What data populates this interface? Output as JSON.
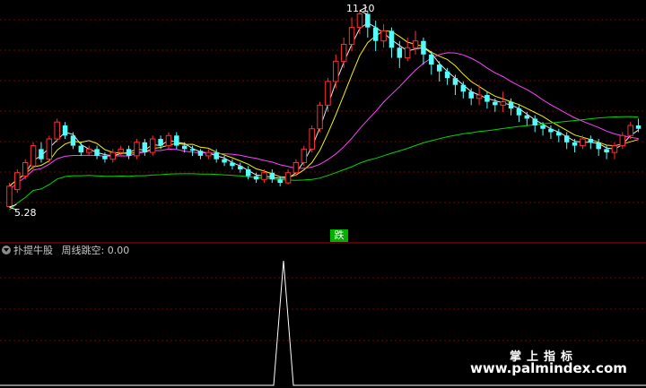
{
  "main_chart": {
    "high_label": "11.10",
    "low_label": "5.28",
    "signal_label": "跌",
    "colors": {
      "up": "#ff3030",
      "down": "#54fcfc",
      "ma_white": "#e8e8e8",
      "ma_yellow": "#f0f000",
      "ma_magenta": "#ff40ff",
      "ma_green": "#00d800",
      "grid": "#7a0000"
    }
  },
  "indicator": {
    "name": "扑提牛股",
    "series_label": "周线跳空:",
    "series_value": "0.00",
    "line_color": "#ffffff"
  },
  "watermark": {
    "line1": "掌上指标",
    "line2": "www.palmindex.com"
  },
  "chart_data": [
    {
      "type": "candlestick",
      "title": "",
      "price_high": 11.1,
      "price_low": 5.28,
      "candles": [
        [
          5.3,
          5.9,
          5.28,
          6.0
        ],
        [
          5.8,
          6.3,
          5.7,
          6.4
        ],
        [
          6.2,
          6.6,
          6.1,
          6.7
        ],
        [
          6.5,
          7.1,
          6.4,
          7.2
        ],
        [
          7.0,
          6.7,
          6.6,
          7.2
        ],
        [
          6.7,
          7.3,
          6.6,
          7.4
        ],
        [
          7.3,
          7.8,
          7.2,
          7.9
        ],
        [
          7.7,
          7.4,
          7.3,
          7.8
        ],
        [
          7.4,
          7.1,
          7.0,
          7.5
        ],
        [
          7.1,
          6.9,
          6.8,
          7.2
        ],
        [
          6.9,
          7.0,
          6.8,
          7.1
        ],
        [
          7.0,
          6.8,
          6.7,
          7.1
        ],
        [
          6.8,
          6.7,
          6.6,
          6.9
        ],
        [
          6.7,
          6.9,
          6.6,
          7.0
        ],
        [
          6.9,
          7.0,
          6.8,
          7.1
        ],
        [
          7.0,
          6.8,
          6.7,
          7.1
        ],
        [
          6.8,
          7.2,
          6.7,
          7.3
        ],
        [
          7.2,
          6.9,
          6.8,
          7.3
        ],
        [
          6.9,
          7.3,
          6.8,
          7.4
        ],
        [
          7.3,
          7.1,
          7.0,
          7.4
        ],
        [
          7.1,
          7.4,
          7.0,
          7.5
        ],
        [
          7.4,
          7.1,
          7.0,
          7.5
        ],
        [
          7.1,
          7.0,
          6.9,
          7.2
        ],
        [
          7.0,
          6.95,
          6.8,
          7.1
        ],
        [
          6.95,
          6.8,
          6.7,
          7.0
        ],
        [
          6.8,
          6.9,
          6.7,
          7.0
        ],
        [
          6.9,
          6.7,
          6.6,
          7.0
        ],
        [
          6.7,
          6.6,
          6.5,
          6.8
        ],
        [
          6.6,
          6.5,
          6.4,
          6.7
        ],
        [
          6.5,
          6.4,
          6.3,
          6.6
        ],
        [
          6.4,
          6.2,
          6.1,
          6.5
        ],
        [
          6.2,
          6.1,
          6.0,
          6.3
        ],
        [
          6.1,
          6.3,
          6.0,
          6.4
        ],
        [
          6.3,
          6.1,
          6.0,
          6.4
        ],
        [
          6.1,
          6.0,
          5.9,
          6.2
        ],
        [
          6.0,
          6.3,
          5.95,
          6.4
        ],
        [
          6.3,
          6.6,
          6.2,
          6.7
        ],
        [
          6.6,
          7.0,
          6.5,
          7.1
        ],
        [
          7.0,
          7.6,
          6.9,
          7.7
        ],
        [
          7.6,
          8.3,
          7.5,
          8.4
        ],
        [
          8.3,
          9.0,
          8.1,
          9.1
        ],
        [
          9.0,
          9.6,
          8.8,
          9.8
        ],
        [
          9.6,
          10.1,
          9.4,
          10.3
        ],
        [
          10.1,
          10.6,
          9.9,
          10.9
        ],
        [
          10.6,
          11.0,
          10.4,
          11.1
        ],
        [
          11.0,
          10.6,
          10.3,
          11.1
        ],
        [
          10.6,
          10.2,
          9.9,
          10.8
        ],
        [
          10.2,
          10.5,
          10.0,
          10.7
        ],
        [
          10.5,
          10.0,
          9.7,
          10.6
        ],
        [
          10.0,
          9.7,
          9.4,
          10.2
        ],
        [
          9.7,
          10.0,
          9.6,
          10.3
        ],
        [
          10.0,
          10.2,
          9.8,
          10.5
        ],
        [
          10.2,
          9.8,
          9.5,
          10.3
        ],
        [
          9.8,
          9.5,
          9.2,
          9.9
        ],
        [
          9.5,
          9.3,
          9.0,
          9.6
        ],
        [
          9.3,
          9.1,
          8.9,
          9.4
        ],
        [
          9.1,
          8.9,
          8.6,
          9.2
        ],
        [
          8.9,
          8.7,
          8.5,
          9.0
        ],
        [
          8.7,
          8.5,
          8.3,
          8.8
        ],
        [
          8.5,
          8.6,
          8.3,
          8.9
        ],
        [
          8.6,
          8.4,
          8.2,
          8.7
        ],
        [
          8.4,
          8.3,
          8.1,
          8.5
        ],
        [
          8.3,
          8.4,
          8.1,
          8.7
        ],
        [
          8.4,
          8.2,
          8.0,
          8.5
        ],
        [
          8.2,
          8.0,
          7.8,
          8.3
        ],
        [
          8.0,
          7.9,
          7.7,
          8.1
        ],
        [
          7.9,
          7.7,
          7.5,
          8.0
        ],
        [
          7.7,
          7.6,
          7.4,
          7.8
        ],
        [
          7.6,
          7.5,
          7.3,
          7.7
        ],
        [
          7.5,
          7.4,
          7.2,
          7.6
        ],
        [
          7.4,
          7.2,
          7.0,
          7.5
        ],
        [
          7.2,
          7.1,
          6.9,
          7.3
        ],
        [
          7.1,
          7.3,
          7.0,
          7.4
        ],
        [
          7.3,
          7.2,
          7.0,
          7.4
        ],
        [
          7.2,
          7.0,
          6.8,
          7.3
        ],
        [
          7.0,
          6.9,
          6.7,
          7.1
        ],
        [
          6.9,
          7.1,
          6.7,
          7.2
        ],
        [
          7.1,
          7.4,
          7.0,
          7.5
        ],
        [
          7.4,
          7.7,
          7.3,
          7.8
        ],
        [
          7.7,
          7.6,
          7.5,
          7.9
        ]
      ],
      "moving_averages": [
        "white",
        "yellow",
        "magenta",
        "green"
      ]
    },
    {
      "type": "line",
      "title": "",
      "series": [
        {
          "name": "周线跳空",
          "peak_bar_index": 38,
          "peak_value": 1,
          "baseline": 0
        }
      ]
    }
  ]
}
